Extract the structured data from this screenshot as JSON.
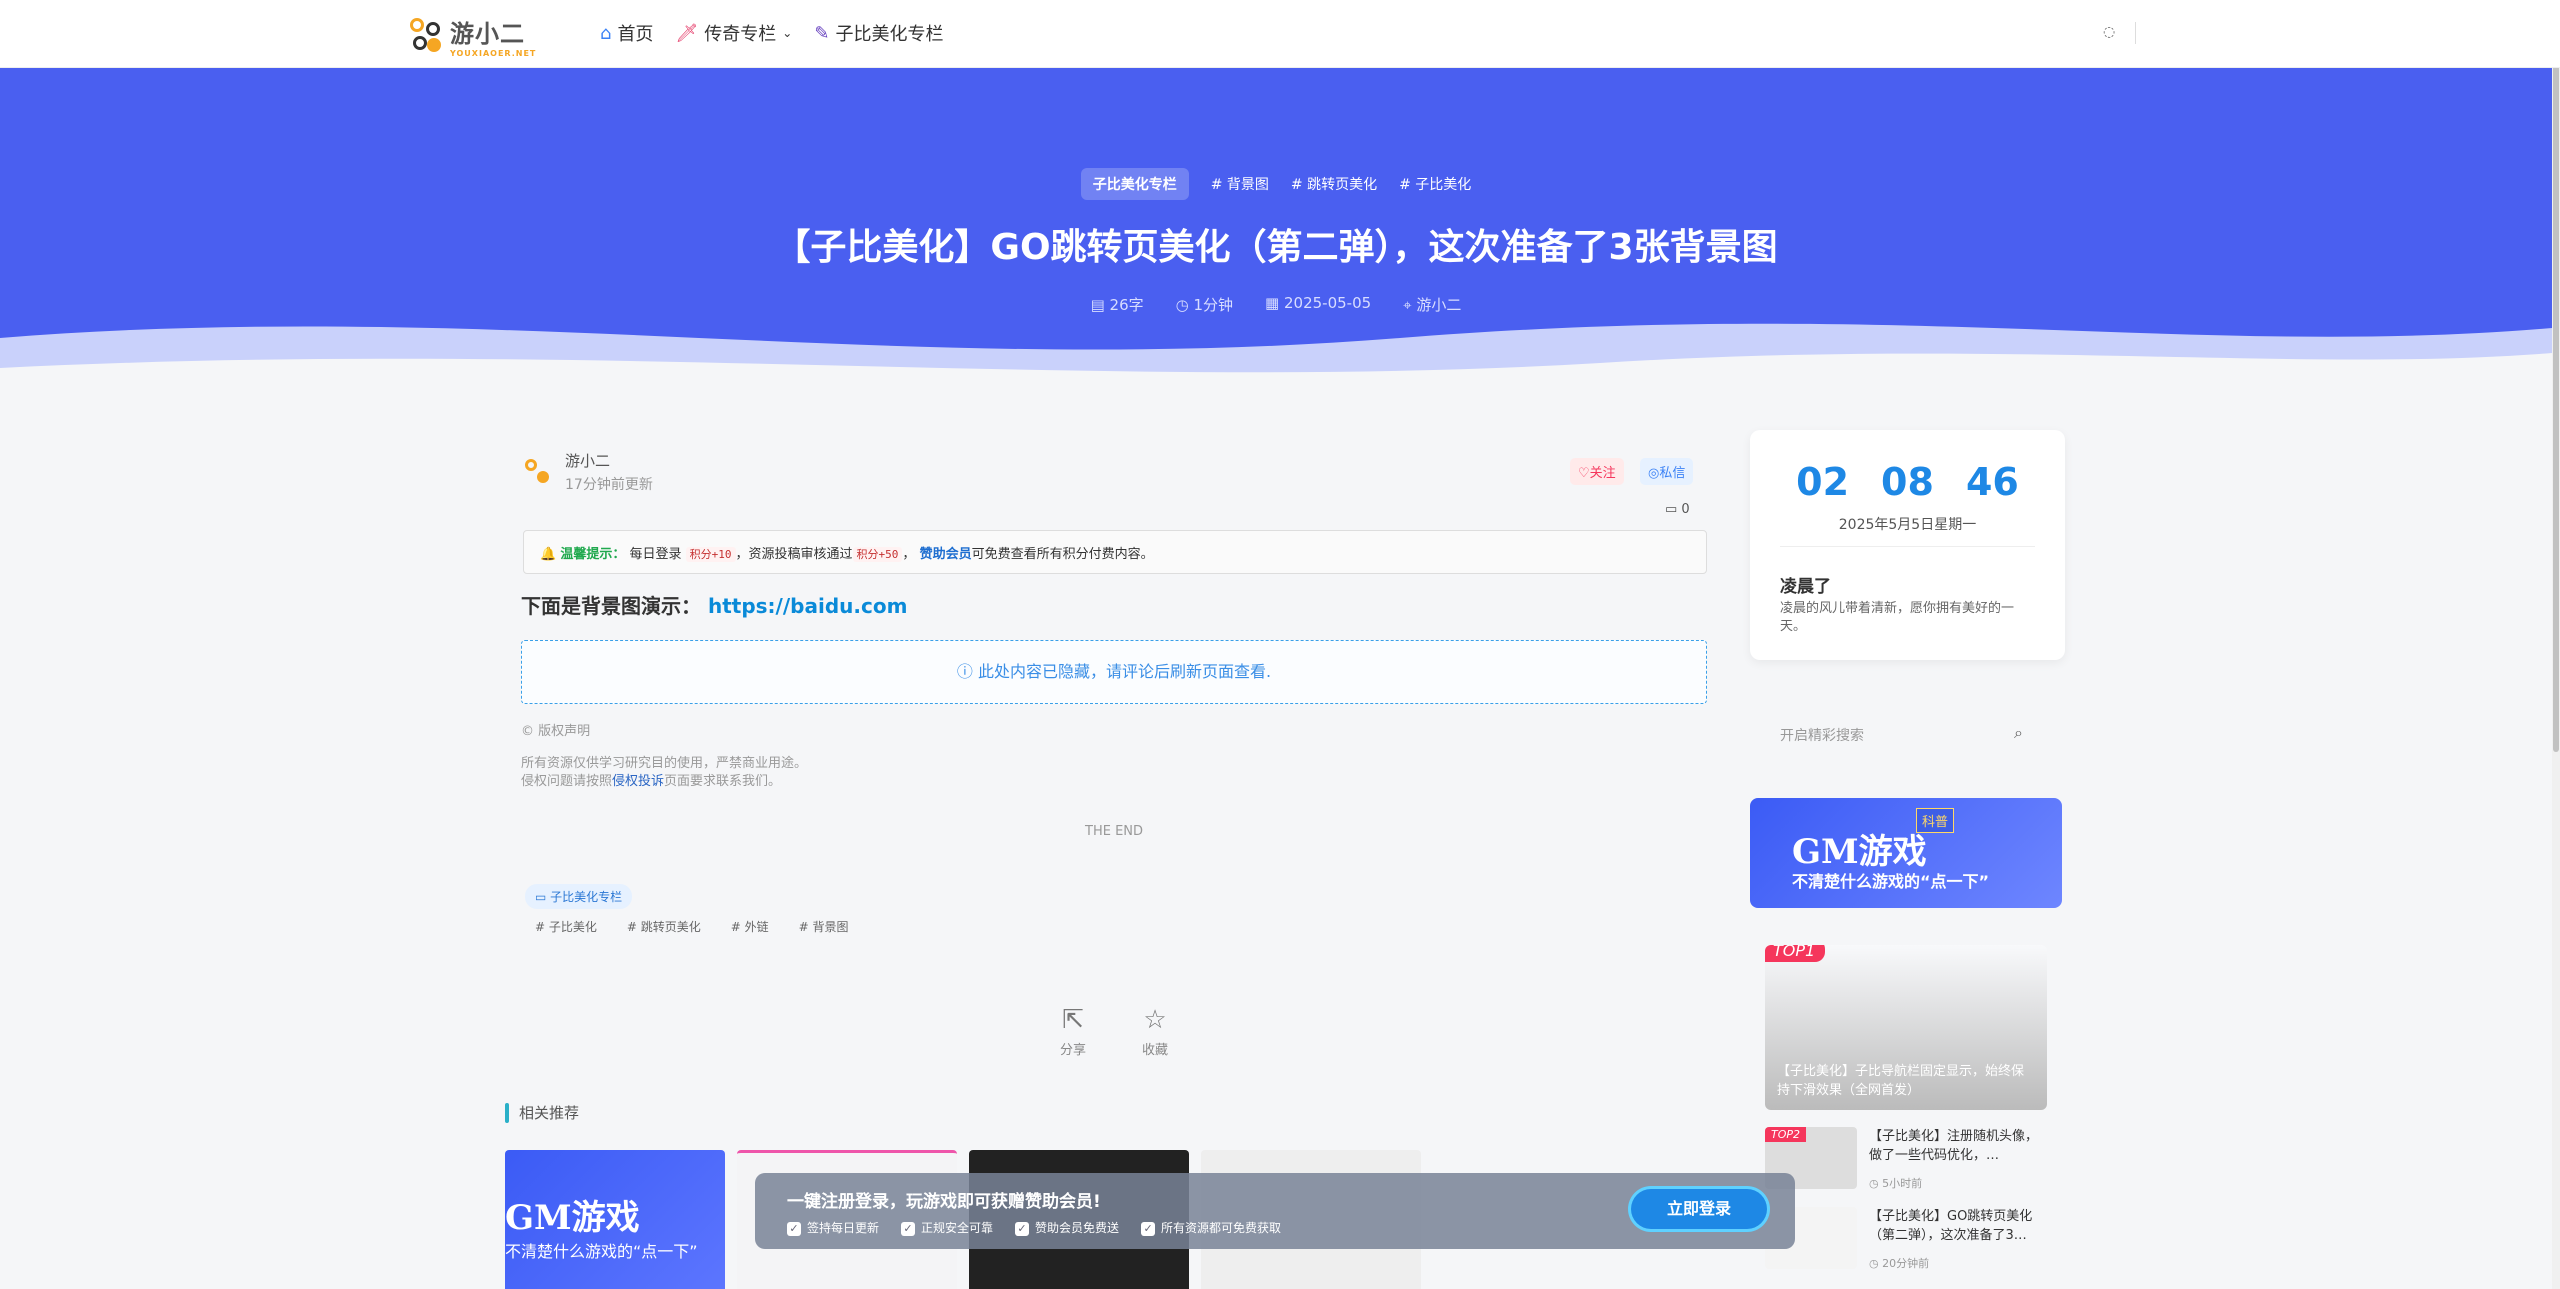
{
  "header": {
    "logo_text": "游小二",
    "logo_sub": "YOUXIAOER.NET",
    "nav": [
      {
        "label": "首页",
        "icon": "home-icon"
      },
      {
        "label": "传奇专栏",
        "icon": "sword-icon"
      },
      {
        "label": "子比美化专栏",
        "icon": "wand-icon"
      }
    ]
  },
  "hero": {
    "category": "子比美化专栏",
    "tags": [
      "# 背景图",
      "# 跳转页美化",
      "# 子比美化"
    ],
    "title": "【子比美化】GO跳转页美化（第二弹），这次准备了3张背景图",
    "meta": {
      "words": "26字",
      "read_time": "1分钟",
      "date": "2025-05-05",
      "author": "游小二"
    }
  },
  "post": {
    "author_name": "游小二",
    "updated": "17分钟前更新",
    "follow": "关注",
    "message": "私信",
    "comments": "0",
    "tip_label": "温馨提示：",
    "tip_1": "每日登录",
    "tip_code1": "积分+10",
    "tip_2": "，资源投稿审核通过",
    "tip_code2": "积分+50",
    "tip_3": "，",
    "tip_link": "赞助会员",
    "tip_4": "可免费查看所有积分付费内容。",
    "demo_label": "下面是背景图演示：",
    "demo_link": "https://baidu.com",
    "hidden_text": "此处内容已隐藏，请评论后刷新页面查看.",
    "copyright_title": "© 版权声明",
    "copyright_1": "所有资源仅供学习研究目的使用，严禁商业用途。",
    "copyright_2a": "侵权问题请按照",
    "copyright_link": "侵权投诉",
    "copyright_2b": "页面要求联系我们。",
    "the_end": "THE END",
    "category_pill": "子比美化专栏",
    "tags": [
      "# 子比美化",
      "# 跳转页美化",
      "# 外链",
      "# 背景图"
    ],
    "share": "分享",
    "favorite": "收藏",
    "related_title": "相关推荐",
    "related_card1_title": "GM游戏",
    "related_card1_sub": "不清楚什么游戏的“点一下”"
  },
  "banner": {
    "title": "一键注册登录，玩游戏即可获赠赞助会员!",
    "checks": [
      "签持每日更新",
      "正规安全可靠",
      "赞助会员免费送",
      "所有资源都可免费获取"
    ],
    "button": "立即登录"
  },
  "sidebar": {
    "clock": {
      "h": "02",
      "m": "08",
      "s": "46"
    },
    "date": "2025年5月5日星期一",
    "greeting_title": "凌晨了",
    "greeting_text": "凌晨的风儿带着清新，愿你拥有美好的一天。",
    "search_placeholder": "开启精彩搜索",
    "gm_title": "GM游戏",
    "gm_sub": "不清楚什么游戏的“点一下”",
    "gm_badge": "科普",
    "top1_tag": "TOP1",
    "top1_title": "【子比美化】子比导航栏固定显示，始终保持下滑效果（全网首发）",
    "top2_tag": "TOP2",
    "top2_title": "【子比美化】注册随机头像，做了一些代码优化，…",
    "top2_time": "5小时前",
    "item3_title": "【子比美化】GO跳转页美化（第二弹），这次准备了3…",
    "item3_time": "20分钟前"
  },
  "colors": {
    "accent": "#4a5ff0",
    "link": "#0a8ad8",
    "danger": "#f5365c"
  }
}
